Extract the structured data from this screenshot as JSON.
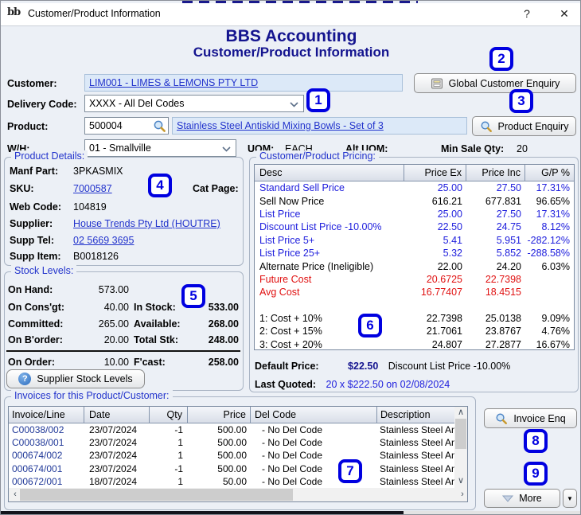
{
  "colors": {
    "navy": "#14148F",
    "blue_text": "#2020DD",
    "red_text": "#E01010",
    "link": "#2233CC",
    "group_title": "#2233CC",
    "badge": "#0000E0",
    "field_bg": "#DCE9F8"
  },
  "window": {
    "logo": "bb",
    "title": "Customer/Product Information",
    "help": "?",
    "close": "✕"
  },
  "header": {
    "app_title": "BBS Accounting",
    "page_title": "Customer/Product Information"
  },
  "form": {
    "customer_label": "Customer:",
    "customer_value": "LIM001 - LIMES & LEMONS PTY LTD",
    "delivery_label": "Delivery Code:",
    "delivery_value": "XXXX - All Del Codes",
    "product_label": "Product:",
    "product_code": "500004",
    "product_desc": "Stainless Steel Antiskid Mixing Bowls - Set of 3",
    "wh_label": "W/H:",
    "wh_value": "01 - Smallville",
    "uom_label": "UOM:",
    "uom_value": "EACH",
    "alt_uom_label": "Alt UOM:",
    "alt_uom_value": "",
    "min_sale_label": "Min Sale Qty:",
    "min_sale_value": "20"
  },
  "buttons": {
    "global_customer_enquiry": "Global Customer Enquiry",
    "product_enquiry": "Product Enquiry",
    "supplier_stock_levels": "Supplier Stock Levels",
    "invoice_enq": "Invoice Enq",
    "more": "More",
    "more_menu_arrow": "▼"
  },
  "product_details": {
    "title": "Product Details:",
    "manf_part_label": "Manf Part:",
    "manf_part": "3PKASMIX",
    "sku_label": "SKU:",
    "sku": "7000587",
    "cat_page_label": "Cat Page:",
    "cat_page": "",
    "web_code_label": "Web Code:",
    "web_code": "104819",
    "supplier_label": "Supplier:",
    "supplier": "House Trends Pty Ltd (HOUTRE)",
    "supp_tel_label": "Supp Tel:",
    "supp_tel": "02 5669 3695",
    "supp_item_label": "Supp Item:",
    "supp_item": "B0018126"
  },
  "stock_levels": {
    "title": "Stock Levels:",
    "rows": [
      {
        "l1": "On Hand:",
        "v1": "573.00",
        "l2": "",
        "v2": ""
      },
      {
        "l1": "On Cons'gt:",
        "v1": "40.00",
        "l2": "In Stock:",
        "v2": "533.00"
      },
      {
        "l1": "Committed:",
        "v1": "265.00",
        "l2": "Available:",
        "v2": "268.00"
      },
      {
        "l1": "On B'order:",
        "v1": "20.00",
        "l2": "Total Stk:",
        "v2": "248.00"
      },
      {
        "l1": "On Order:",
        "v1": "10.00",
        "l2": "F'cast:",
        "v2": "258.00"
      }
    ]
  },
  "pricing": {
    "title": "Customer/Product Pricing:",
    "columns": [
      "Desc",
      "Price Ex",
      "Price Inc",
      "G/P %"
    ],
    "rows": [
      {
        "desc": "Standard Sell Price",
        "ex": "25.00",
        "inc": "27.50",
        "gp": "17.31%",
        "color": "blue"
      },
      {
        "desc": "Sell Now Price",
        "ex": "616.21",
        "inc": "677.831",
        "gp": "96.65%",
        "color": "black"
      },
      {
        "desc": "List Price",
        "ex": "25.00",
        "inc": "27.50",
        "gp": "17.31%",
        "color": "blue"
      },
      {
        "desc": "Discount List Price -10.00%",
        "ex": "22.50",
        "inc": "24.75",
        "gp": "8.12%",
        "color": "blue"
      },
      {
        "desc": "List Price 5+",
        "ex": "5.41",
        "inc": "5.951",
        "gp": "-282.12%",
        "color": "blue"
      },
      {
        "desc": "List Price 25+",
        "ex": "5.32",
        "inc": "5.852",
        "gp": "-288.58%",
        "color": "blue"
      },
      {
        "desc": "Alternate Price (Ineligible)",
        "ex": "22.00",
        "inc": "24.20",
        "gp": "6.03%",
        "color": "black"
      },
      {
        "desc": "Future Cost",
        "ex": "20.6725",
        "inc": "22.7398",
        "gp": "",
        "color": "red"
      },
      {
        "desc": "Avg Cost",
        "ex": "16.77407",
        "inc": "18.4515",
        "gp": "",
        "color": "red"
      },
      {
        "desc": "",
        "ex": "",
        "inc": "",
        "gp": "",
        "color": "black"
      },
      {
        "desc": "1: Cost + 10%",
        "ex": "22.7398",
        "inc": "25.0138",
        "gp": "9.09%",
        "color": "black"
      },
      {
        "desc": "2: Cost + 15%",
        "ex": "21.7061",
        "inc": "23.8767",
        "gp": "4.76%",
        "color": "black"
      },
      {
        "desc": "3: Cost + 20%",
        "ex": "24.807",
        "inc": "27.2877",
        "gp": "16.67%",
        "color": "black"
      }
    ],
    "default_price_label": "Default Price:",
    "default_price_value": "$22.50",
    "default_price_note": "Discount List Price -10.00%",
    "last_quoted_label": "Last Quoted:",
    "last_quoted_value": "20 x $222.50 on 02/08/2024"
  },
  "invoices": {
    "title": "Invoices for this Product/Customer:",
    "columns": [
      "Invoice/Line",
      "Date",
      "Qty",
      "Price",
      "Del Code",
      "Description"
    ],
    "rows": [
      {
        "invoice": "C00038/002",
        "date": "23/07/2024",
        "qty": "-1",
        "price": "500.00",
        "del": "- No Del Code",
        "desc": "Stainless Steel Antis"
      },
      {
        "invoice": "C00038/001",
        "date": "23/07/2024",
        "qty": "1",
        "price": "500.00",
        "del": "- No Del Code",
        "desc": "Stainless Steel Antis"
      },
      {
        "invoice": "000674/002",
        "date": "23/07/2024",
        "qty": "1",
        "price": "500.00",
        "del": "- No Del Code",
        "desc": "Stainless Steel Antis"
      },
      {
        "invoice": "000674/001",
        "date": "23/07/2024",
        "qty": "-1",
        "price": "500.00",
        "del": "- No Del Code",
        "desc": "Stainless Steel Antis"
      },
      {
        "invoice": "000672/001",
        "date": "18/07/2024",
        "qty": "1",
        "price": "50.00",
        "del": "- No Del Code",
        "desc": "Stainless Steel Antis"
      }
    ]
  },
  "scroll": {
    "left": "‹",
    "right": "›",
    "up": "∧",
    "down": "∨"
  },
  "annotations": [
    "1",
    "2",
    "3",
    "4",
    "5",
    "6",
    "7",
    "8",
    "9"
  ]
}
